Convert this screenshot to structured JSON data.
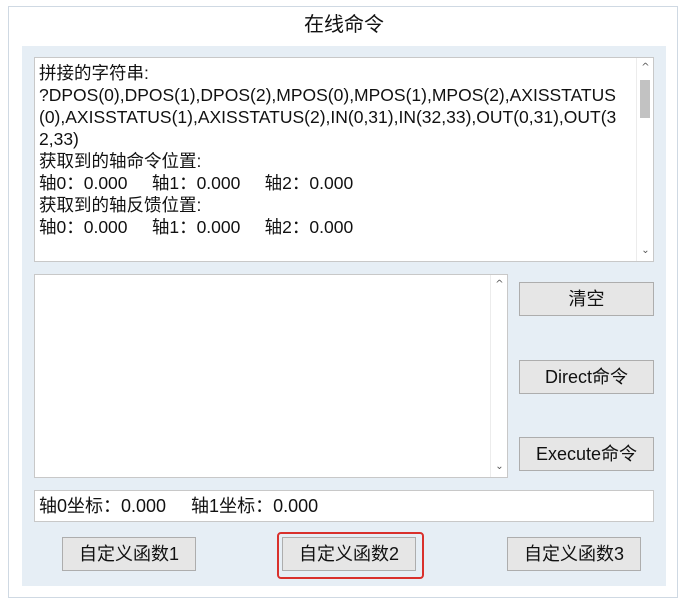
{
  "window": {
    "title": "在线命令"
  },
  "log": {
    "text": "拼接的字符串:\n?DPOS(0),DPOS(1),DPOS(2),MPOS(0),MPOS(1),MPOS(2),AXISSTATUS(0),AXISSTATUS(1),AXISSTATUS(2),IN(0,31),IN(32,33),OUT(0,31),OUT(32,33)\n获取到的轴命令位置:\n轴0：0.000     轴1：0.000     轴2：0.000\n获取到的轴反馈位置:\n轴0：0.000     轴1：0.000     轴2：0.000"
  },
  "command_input": {
    "value": ""
  },
  "buttons": {
    "clear": "清空",
    "direct": "Direct命令",
    "execute": "Execute命令",
    "custom1": "自定义函数1",
    "custom2": "自定义函数2",
    "custom3": "自定义函数3"
  },
  "coordinates": {
    "text": "轴0坐标：0.000     轴1坐标：0.000"
  },
  "colors": {
    "highlight": "#d9302c",
    "panel_bg": "#e6eef5"
  },
  "icons": {
    "scroll_up": "chevron-up-icon",
    "scroll_down": "chevron-down-icon"
  }
}
